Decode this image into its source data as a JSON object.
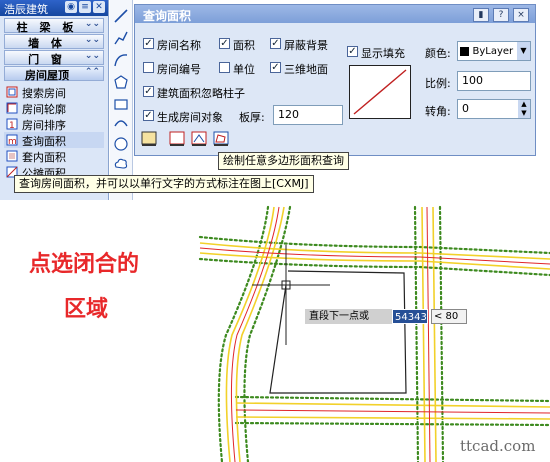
{
  "palette": {
    "title": "浩辰建筑",
    "menus": [
      "柱 梁 板",
      "墙 体",
      "门 窗",
      "房间屋顶"
    ],
    "items": [
      "搜索房间",
      "房间轮廓",
      "房间排序",
      "查询面积",
      "套内面积",
      "公摊面积"
    ]
  },
  "dialog": {
    "title": "查询面积",
    "title_buttons": [
      "pin",
      "?",
      "×"
    ],
    "checks": [
      {
        "label": "房间名称",
        "checked": true
      },
      {
        "label": "面积",
        "checked": true
      },
      {
        "label": "屏蔽背景",
        "checked": true
      },
      {
        "label": "房间编号",
        "checked": false
      },
      {
        "label": "单位",
        "checked": false
      },
      {
        "label": "三维地面",
        "checked": true
      },
      {
        "label": "建筑面积忽略柱子",
        "checked": true
      },
      {
        "label": "生成房间对象",
        "checked": true
      },
      {
        "label": "显示填充",
        "checked": true
      }
    ],
    "thickness_label": "板厚:",
    "thickness_value": "120",
    "color_label": "颜色:",
    "color_value": "ByLayer",
    "scale_label": "比例:",
    "scale_value": "100",
    "angle_label": "转角:",
    "angle_value": "0"
  },
  "tooltips": {
    "draw": "绘制任意多边形面积查询",
    "query": "查询房间面积，并可以以单行文字的方式标注在图上[CXMJ]"
  },
  "canvas": {
    "annotation_line1": "点选闭合的",
    "annotation_line2": "区域",
    "prompt": "直段下一点或",
    "coord_value": "54343",
    "angle_input": "< 80"
  },
  "watermark": "ttcad.com",
  "colors": {
    "road_yellow": "#f2d12a",
    "axis_red": "#e0252a",
    "tree_green": "#3d8a1f",
    "annotation_red": "#e8282a"
  }
}
